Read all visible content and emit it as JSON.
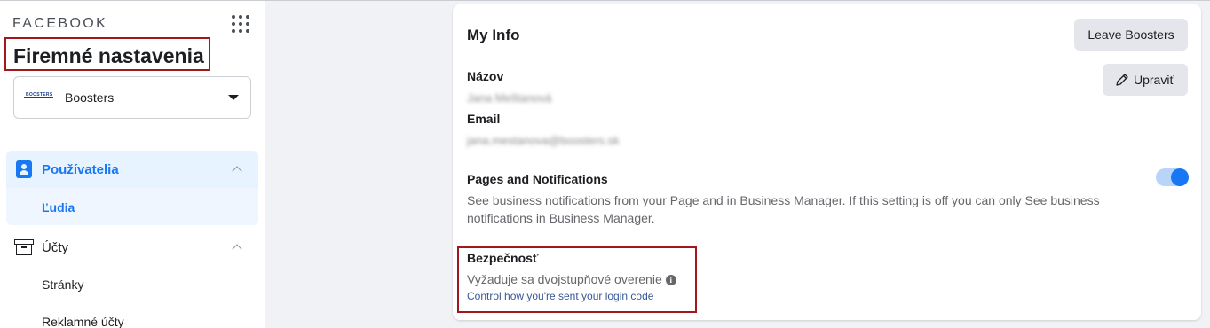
{
  "sidebar": {
    "brand": "FACEBOOK",
    "title": "Firemné nastavenia",
    "account": {
      "name": "Boosters",
      "logo_text": "BOOSTERS"
    },
    "nav": {
      "users": "Používatelia",
      "people": "Ľudia",
      "accounts": "Účty",
      "pages": "Stránky",
      "ad_accounts": "Reklamné účty"
    }
  },
  "card": {
    "title": "My Info",
    "leave_button": "Leave Boosters",
    "edit_button": "Upraviť",
    "name_label": "Názov",
    "name_value": "Jana Meštanová",
    "email_label": "Email",
    "email_value": "jana.mestanova@boosters.sk",
    "notifications_label": "Pages and Notifications",
    "notifications_desc": "See business notifications from your Page and in Business Manager. If this setting is off you can only See business notifications in Business Manager.",
    "notifications_enabled": true,
    "security_label": "Bezpečnosť",
    "security_requirement": "Vyžaduje sa dvojstupňové overenie",
    "security_link": "Control how you're sent your login code"
  },
  "colors": {
    "accent": "#1877f2",
    "highlight_border": "#a0171c",
    "link": "#385898"
  }
}
